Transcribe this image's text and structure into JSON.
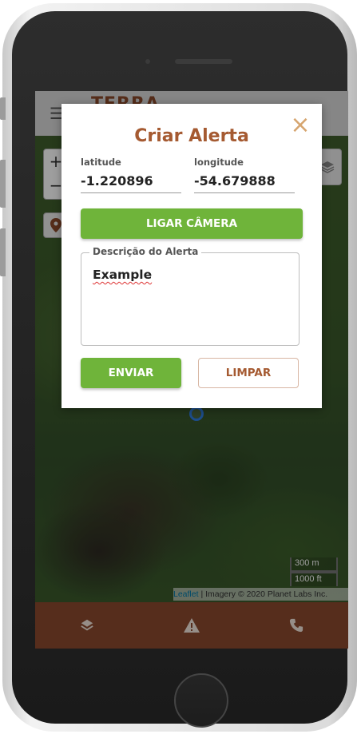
{
  "app": {
    "logo_text": "TERRA",
    "menu_icon": "hamburger-menu-icon"
  },
  "map": {
    "zoom_in_label": "+",
    "zoom_out_label": "−",
    "scale_metric": "300 m",
    "scale_imperial": "1000 ft",
    "attribution_link": "Leaflet",
    "attribution_text": " | Imagery © 2020 Planet Labs Inc."
  },
  "modal": {
    "title": "Criar Alerta",
    "close_label": "×",
    "latitude_label": "latitude",
    "latitude_value": "-1.220896",
    "longitude_label": "longitude",
    "longitude_value": "-54.679888",
    "camera_button": "LIGAR CÂMERA",
    "description_legend": "Descrição do Alerta",
    "description_value": "Example",
    "send_button": "ENVIAR",
    "clear_button": "LIMPAR"
  },
  "bottom_nav": {
    "items": [
      {
        "icon": "layers-icon"
      },
      {
        "icon": "warning-icon"
      },
      {
        "icon": "phone-icon"
      }
    ]
  },
  "colors": {
    "brand_brown": "#8b4a2e",
    "title_brown": "#a55a31",
    "accent_green": "#6fb43a",
    "close_tan": "#d6a56f"
  }
}
